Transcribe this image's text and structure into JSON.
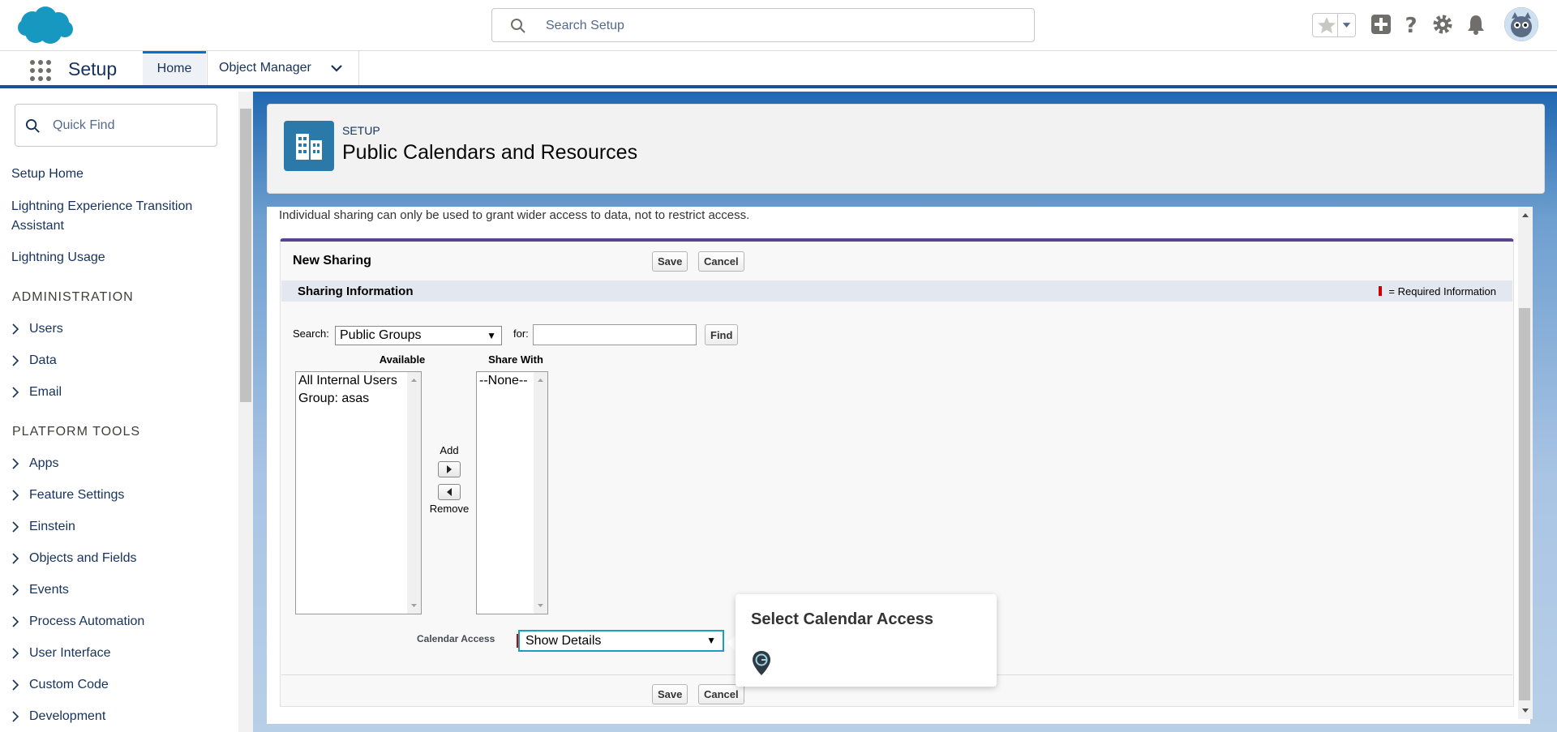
{
  "header": {
    "search_placeholder": "Search Setup",
    "icons": [
      "salesforce-cloud-logo",
      "search-icon",
      "star-icon",
      "chevron-down-icon",
      "add-icon",
      "help-icon",
      "gear-icon",
      "bell-icon",
      "avatar"
    ]
  },
  "nav": {
    "app_title": "Setup",
    "tabs": [
      {
        "label": "Home",
        "active": true
      },
      {
        "label": "Object Manager",
        "active": false
      }
    ]
  },
  "sidebar": {
    "quick_find_placeholder": "Quick Find",
    "links": [
      "Setup Home",
      "Lightning Experience Transition Assistant",
      "Lightning Usage"
    ],
    "admin_heading": "ADMINISTRATION",
    "admin_items": [
      "Users",
      "Data",
      "Email"
    ],
    "platform_heading": "PLATFORM TOOLS",
    "platform_items": [
      "Apps",
      "Feature Settings",
      "Einstein",
      "Objects and Fields",
      "Events",
      "Process Automation",
      "User Interface",
      "Custom Code",
      "Development"
    ]
  },
  "page_header": {
    "eyebrow": "SETUP",
    "title": "Public Calendars and Resources"
  },
  "content": {
    "intro": "Individual sharing can only be used to grant wider access to data, not to restrict access.",
    "panel_title": "New Sharing",
    "save_label": "Save",
    "cancel_label": "Cancel",
    "section_title": "Sharing Information",
    "required_note": "= Required Information",
    "search_label": "Search:",
    "search_select_value": "Public Groups",
    "for_label": "for:",
    "for_value": "",
    "find_label": "Find",
    "available_heading": "Available",
    "available_options": [
      "All Internal Users",
      "Group: asas"
    ],
    "share_with_heading": "Share With",
    "share_with_options": [
      "--None--"
    ],
    "add_label": "Add",
    "remove_label": "Remove",
    "calendar_access_label": "Calendar Access",
    "calendar_access_value": "Show Details"
  },
  "popover": {
    "title": "Select Calendar Access"
  },
  "colors": {
    "brand_blue": "#1b5297",
    "accent_teal": "#1a9dbf",
    "panel_border": "#56458c",
    "required_red": "#cc0000"
  }
}
